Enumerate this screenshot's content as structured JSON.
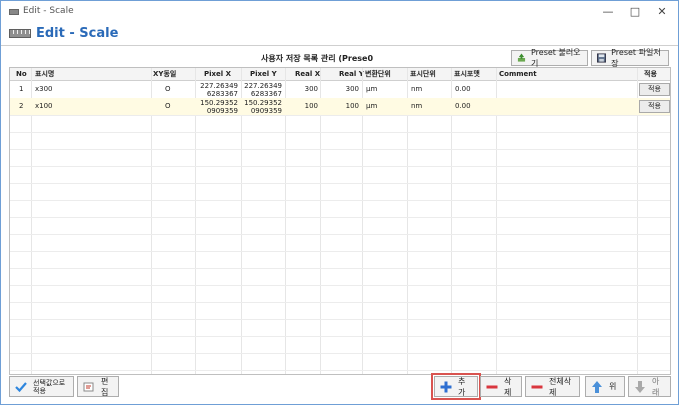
{
  "window": {
    "title": "Edit - Scale",
    "minimize": "—",
    "maximize": "□",
    "close": "✕"
  },
  "header": {
    "title": "Edit - Scale"
  },
  "grid_caption": "사용자 저장 목록 관리 (Prese0",
  "toolbar": {
    "preset_load": "Preset 불러오기",
    "preset_save": "Preset 파일저장"
  },
  "columns": [
    "No",
    "표시명",
    "XY동일",
    "Pixel X",
    "Pixel Y",
    "Real X",
    "Real Y",
    "변환단위",
    "표시단위",
    "표시포맷",
    "Comment",
    "적용"
  ],
  "rows": [
    {
      "no": "1",
      "name": "x300",
      "xy_same": "O",
      "pixel_x_1": "227.26349",
      "pixel_x_2": "6283367",
      "pixel_y_1": "227.26349",
      "pixel_y_2": "6283367",
      "real_x": "300",
      "real_y": "300",
      "conv_unit": "μm",
      "disp_unit": "nm",
      "format": "0.00",
      "comment": "",
      "apply": "적용"
    },
    {
      "no": "2",
      "name": "x100",
      "xy_same": "O",
      "pixel_x_1": "150.29352",
      "pixel_x_2": "0909359",
      "pixel_y_1": "150.29352",
      "pixel_y_2": "0909359",
      "real_x": "100",
      "real_y": "100",
      "conv_unit": "μm",
      "disp_unit": "nm",
      "format": "0.00",
      "comment": "",
      "apply": "적용"
    }
  ],
  "bottom": {
    "apply_selected": "선택값으로\n적용",
    "edit": "편집",
    "add": "추가",
    "delete": "삭제",
    "delete_all": "전체삭제",
    "up": "위",
    "down": "아래"
  },
  "colors": {
    "accent": "#2a6ab8",
    "selected_row": "#fffbe3",
    "highlight_border": "#d9534f"
  }
}
